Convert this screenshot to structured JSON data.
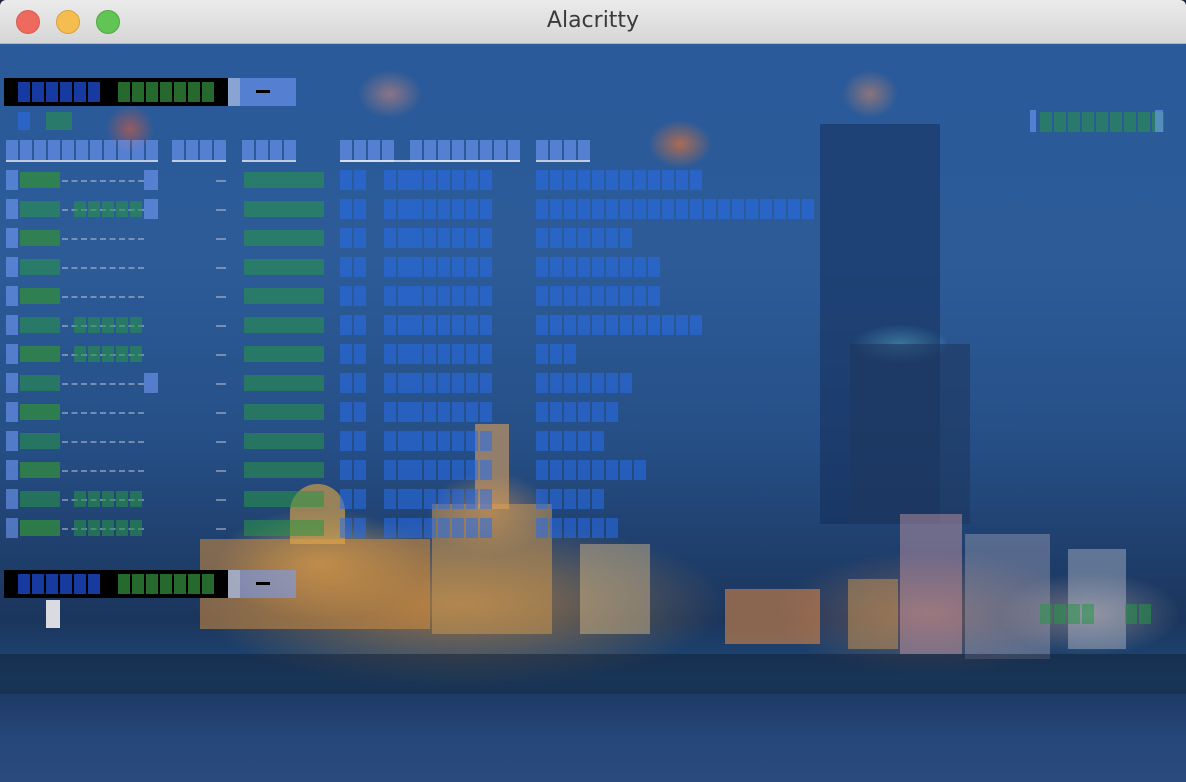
{
  "window": {
    "title": "Alacritty"
  },
  "colors": {
    "close": "#ee6a5f",
    "minimize": "#f5bd4f",
    "maximize": "#61c454",
    "terminal_text_blue": "#2a6ee6",
    "terminal_text_green": "#2f9a4a"
  },
  "terminal": {
    "rows": 15,
    "cursor_visible": true
  }
}
